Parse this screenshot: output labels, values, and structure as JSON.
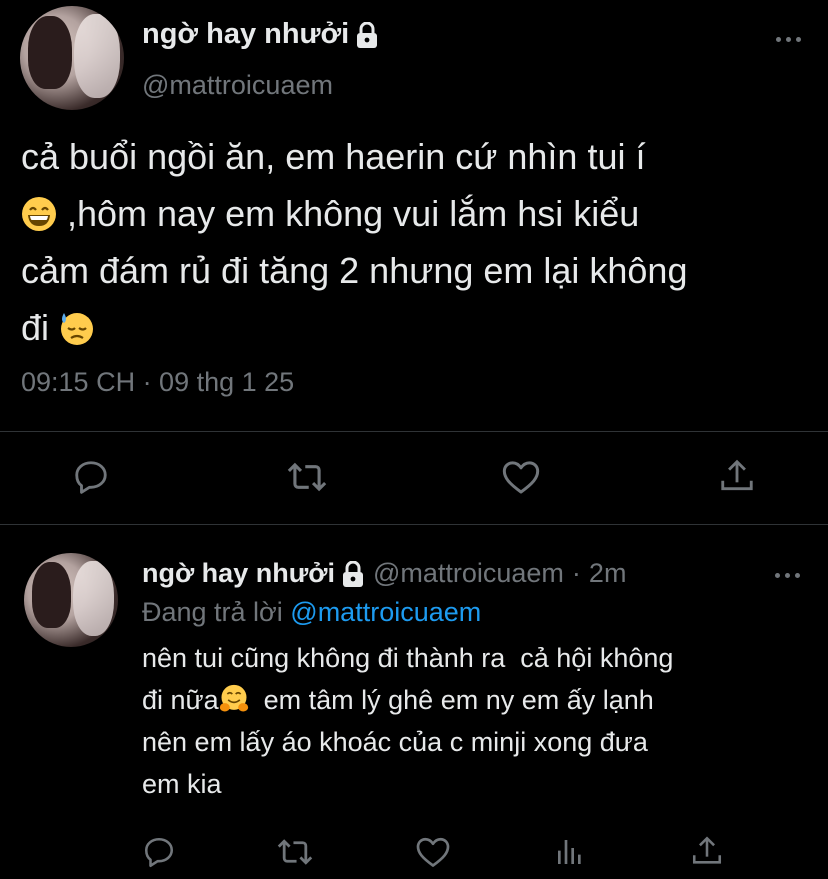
{
  "main_tweet": {
    "display_name": "ngờ hay nhưởi",
    "handle": "@mattroicuaem",
    "text_line1": "cả buổi ngồi ăn, em haerin cứ nhìn tui í",
    "text_line2": " ,hôm nay em không vui lắm hsi kiểu",
    "text_line3": "cảm đám rủ đi tăng 2 nhưng em lại không",
    "text_line4": "đi ",
    "emoji_1": "grinning-face-emoji",
    "emoji_2": "downcast-sweat-face-emoji",
    "timestamp": "09:15 CH · 09 thg 1 25",
    "actions": [
      "reply-icon",
      "retweet-icon",
      "like-icon",
      "share-icon"
    ]
  },
  "reply_tweet": {
    "display_name": "ngờ hay nhưởi",
    "handle": "@mattroicuaem",
    "separator": "·",
    "time_ago": "2m",
    "replying_label": "Đang trả lời",
    "replying_to": "@mattroicuaem",
    "text_part1": "nên tui cũng không đi thành ra  cả hội không\nđi nữa",
    "text_part2": "  em tâm lý ghê em ny em ấy lạnh\nnên em lấy áo khoác của c minji xong đưa\nem kia",
    "emoji": "hugging-face-emoji",
    "actions": [
      "reply-icon",
      "retweet-icon",
      "like-icon",
      "views-icon",
      "share-icon"
    ]
  },
  "colors": {
    "background": "#000000",
    "text": "#e7e9ea",
    "muted": "#71767b",
    "link": "#1d9bf0",
    "divider": "#2f3336"
  }
}
